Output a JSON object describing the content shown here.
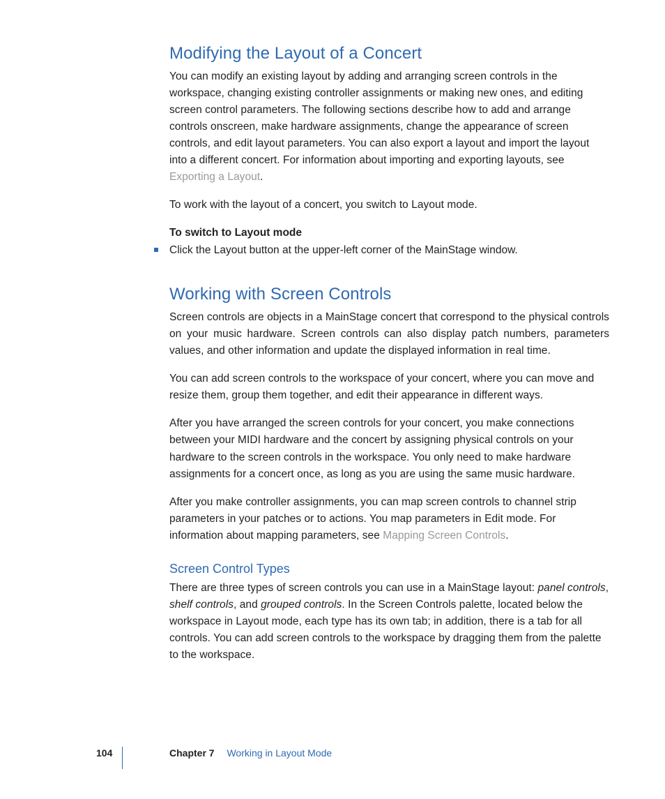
{
  "section1": {
    "heading": "Modifying the Layout of a Concert",
    "para1_leading": "You can modify an existing layout by adding and arranging screen controls in the workspace, changing existing controller assignments or making new ones, and editing screen control parameters. The following sections describe how to add and arrange controls onscreen, make hardware assignments, change the appearance of screen controls, and edit layout parameters. You can also export a layout and import the layout into a different concert. For information about importing and exporting layouts, see ",
    "para1_link": "Exporting a Layout",
    "para1_trailing": ".",
    "para2": "To work with the layout of a concert, you switch to Layout mode.",
    "lead": "To switch to Layout mode",
    "bullet": "Click the Layout button at the upper-left corner of the MainStage window."
  },
  "section2": {
    "heading": "Working with Screen Controls",
    "para1": "Screen controls are objects in a MainStage concert that correspond to the physical controls on your music hardware. Screen controls can also display patch numbers, parameters values, and other information and update the displayed information in real time.",
    "para2": "You can add screen controls to the workspace of your concert, where you can move and resize them, group them together, and edit their appearance in different ways.",
    "para3": "After you have arranged the screen controls for your concert, you make connections between your MIDI hardware and the concert by assigning physical controls on your hardware to the screen controls in the workspace. You only need to make hardware assignments for a concert once, as long as you are using the same music hardware.",
    "para4_leading": "After you make controller assignments, you can map screen controls to channel strip parameters in your patches or to actions. You map parameters in Edit mode. For information about mapping parameters, see ",
    "para4_link": "Mapping Screen Controls",
    "para4_trailing": "."
  },
  "subsection": {
    "heading": "Screen Control Types",
    "para_a": "There are three types of screen controls you can use in a MainStage layout: ",
    "it1": "panel controls",
    "sep1": ", ",
    "it2": "shelf controls",
    "sep2": ", and ",
    "it3": "grouped controls",
    "para_b": ". In the Screen Controls palette, located below the workspace in Layout mode, each type has its own tab; in addition, there is a tab for all controls. You can add screen controls to the workspace by dragging them from the palette to the workspace."
  },
  "footer": {
    "page": "104",
    "chapter_label": "Chapter 7",
    "chapter_title": "Working in Layout Mode"
  }
}
